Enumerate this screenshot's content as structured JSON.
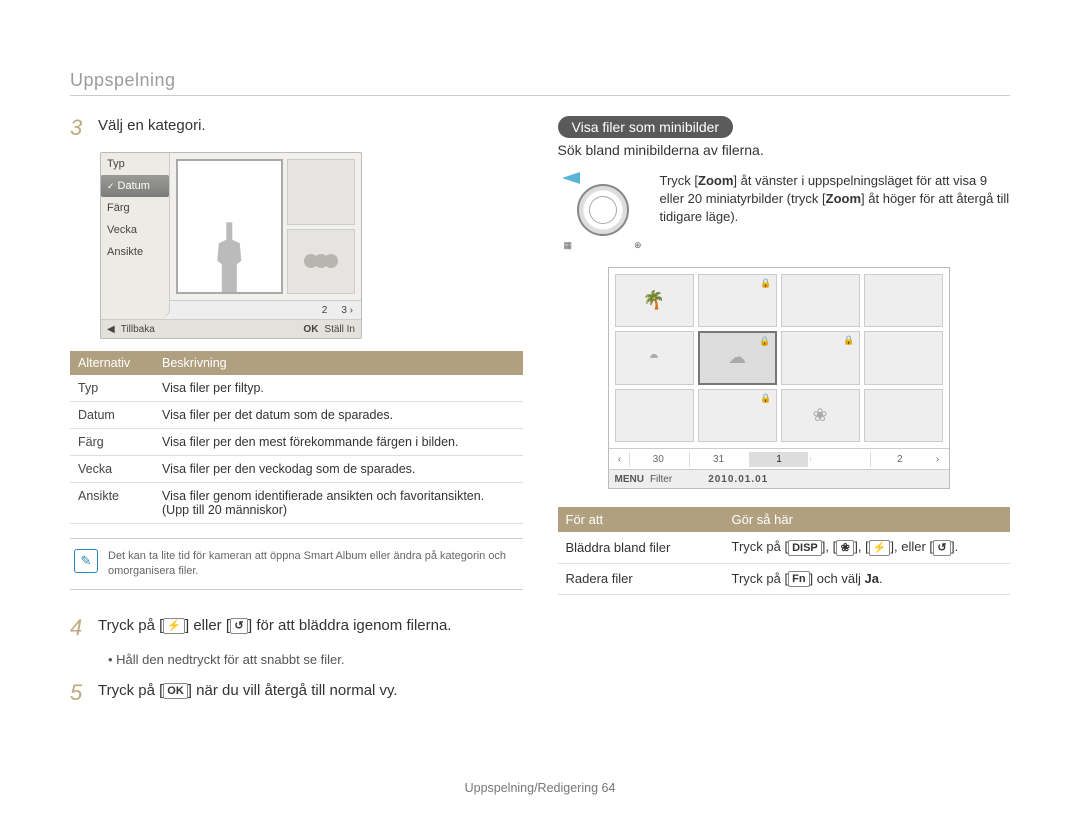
{
  "section_title": "Uppspelning",
  "steps": {
    "s3": {
      "num": "3",
      "text": "Välj en kategori."
    },
    "s4": {
      "num": "4",
      "text_pre": "Tryck på [",
      "key1": "⚡",
      "text_mid": "] eller [",
      "key2": "↺",
      "text_post": "] för att bläddra igenom filerna."
    },
    "s4_bullet": "Håll den nedtryckt för att snabbt se filer.",
    "s5": {
      "num": "5",
      "text_pre": "Tryck på [",
      "key": "OK",
      "text_post": "] när du vill återgå till normal vy."
    }
  },
  "screen1": {
    "categories": [
      "Typ",
      "Datum",
      "Färg",
      "Vecka",
      "Ansikte"
    ],
    "nav_2": "2",
    "nav_3": "3",
    "back": "Tillbaka",
    "ok": "OK",
    "set": "Ställ In"
  },
  "table1": {
    "h1": "Alternativ",
    "h2": "Beskrivning",
    "rows": [
      {
        "a": "Typ",
        "b": "Visa filer per filtyp."
      },
      {
        "a": "Datum",
        "b": "Visa filer per det datum som de sparades."
      },
      {
        "a": "Färg",
        "b": "Visa filer per den mest förekommande färgen i bilden."
      },
      {
        "a": "Vecka",
        "b": "Visa filer per den veckodag som de sparades."
      },
      {
        "a": "Ansikte",
        "b": "Visa filer genom identifierade ansikten och favoritansikten. (Upp till 20 människor)"
      }
    ]
  },
  "note": "Det kan ta lite tid för kameran att öppna Smart Album eller ändra på kategorin och omorganisera filer.",
  "right": {
    "pill": "Visa filer som minibilder",
    "sub": "Sök bland minibilderna av filerna.",
    "zoom_pre": "Tryck [",
    "zoom_key": "Zoom",
    "zoom_mid1": "] åt vänster i uppspelningsläget för att visa 9 eller 20 miniatyrbilder (tryck [",
    "zoom_mid2": "] åt höger för att återgå till tidigare läge)."
  },
  "screen2": {
    "dates": [
      "30",
      "31",
      "1",
      "",
      "2"
    ],
    "menu": "MENU",
    "filter": "Filter",
    "full_date": "2010.01.01"
  },
  "table2": {
    "h1": "För att",
    "h2": "Gör så här",
    "row1": {
      "a": "Bläddra bland filer",
      "b_pre": "Tryck på [",
      "k1": "DISP",
      "k2": "❀",
      "k3": "⚡",
      "k4": "↺",
      "b_mid1": "], [",
      "b_mid2": "], [",
      "b_mid3": "], eller [",
      "b_post": "]."
    },
    "row2": {
      "a": "Radera filer",
      "b_pre": "Tryck på [",
      "k": "Fn",
      "b_mid": "] och välj ",
      "b_bold": "Ja",
      "b_post": "."
    }
  },
  "footer": "Uppspelning/Redigering  64",
  "chart_data": {
    "type": "table",
    "tables": [
      {
        "headers": [
          "Alternativ",
          "Beskrivning"
        ],
        "rows": [
          [
            "Typ",
            "Visa filer per filtyp."
          ],
          [
            "Datum",
            "Visa filer per det datum som de sparades."
          ],
          [
            "Färg",
            "Visa filer per den mest förekommande färgen i bilden."
          ],
          [
            "Vecka",
            "Visa filer per den veckodag som de sparades."
          ],
          [
            "Ansikte",
            "Visa filer genom identifierade ansikten och favoritansikten. (Upp till 20 människor)"
          ]
        ]
      },
      {
        "headers": [
          "För att",
          "Gör så här"
        ],
        "rows": [
          [
            "Bläddra bland filer",
            "Tryck på [DISP], [❀], [⚡], eller [↺]."
          ],
          [
            "Radera filer",
            "Tryck på [Fn] och välj Ja."
          ]
        ]
      }
    ]
  }
}
